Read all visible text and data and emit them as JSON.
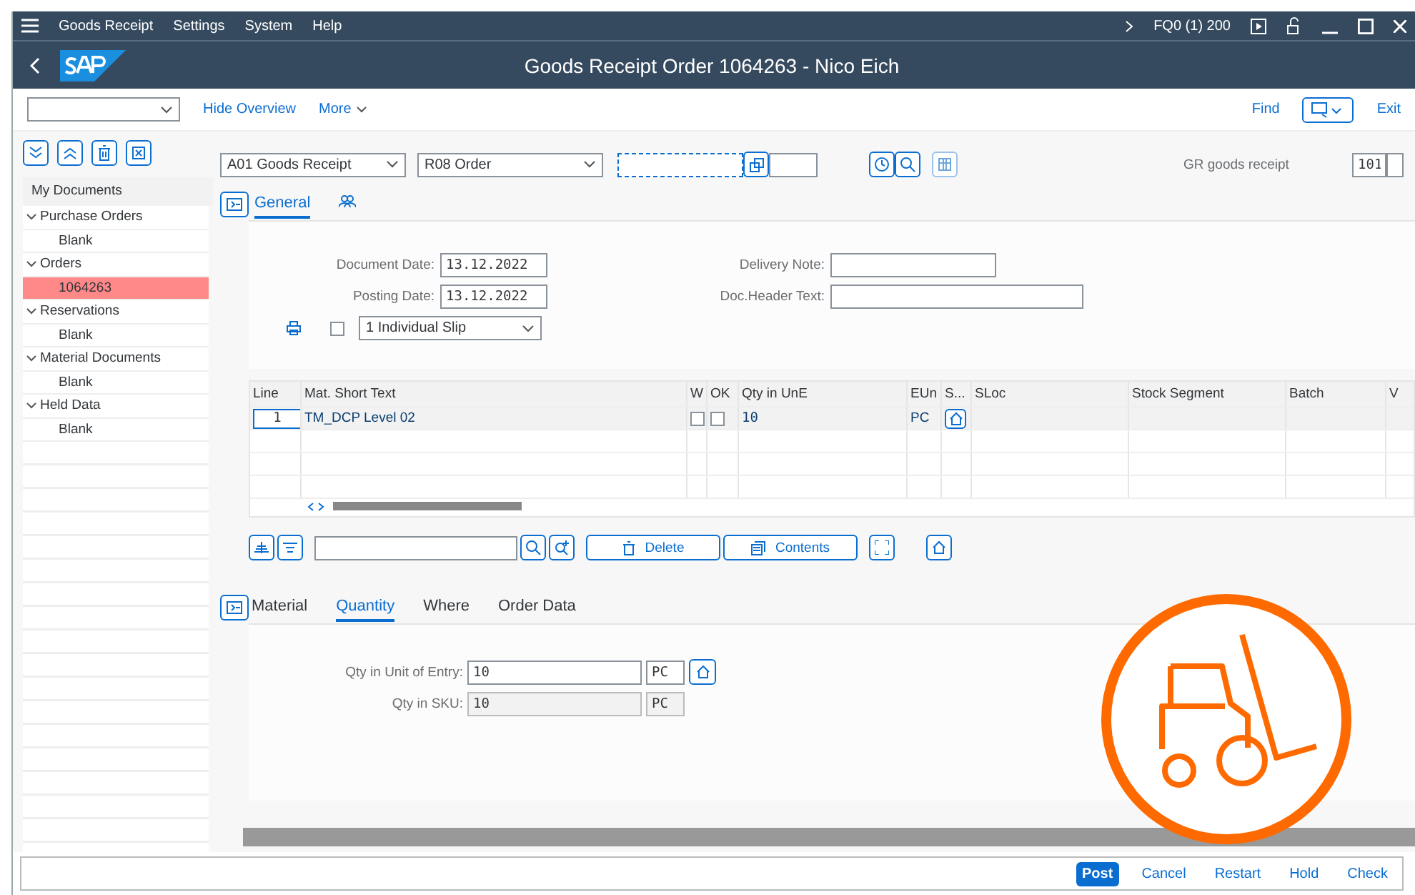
{
  "menu_bar": {
    "items": [
      "Goods Receipt",
      "Settings",
      "System",
      "Help"
    ],
    "system": "FQ0 (1) 200"
  },
  "title": "Goods Receipt Order 1064263 - Nico Eich",
  "toolbar": {
    "links": [
      "Hide Overview",
      "More"
    ],
    "right": [
      "Find",
      "Exit"
    ]
  },
  "tree": {
    "header": "My Documents",
    "items": [
      {
        "label": "Purchase Orders",
        "expanded": true,
        "selected": false,
        "children": [
          {
            "label": "Blank",
            "selected": false
          }
        ]
      },
      {
        "label": "Orders",
        "expanded": true,
        "selected": false,
        "children": [
          {
            "label": "1064263",
            "selected": true
          }
        ]
      },
      {
        "label": "Reservations",
        "expanded": true,
        "selected": false,
        "children": [
          {
            "label": "Blank",
            "selected": false
          }
        ]
      },
      {
        "label": "Material Documents",
        "expanded": true,
        "selected": false,
        "children": [
          {
            "label": "Blank",
            "selected": false
          }
        ]
      },
      {
        "label": "Held Data",
        "expanded": true,
        "selected": false,
        "children": [
          {
            "label": "Blank",
            "selected": false
          }
        ]
      }
    ]
  },
  "header": {
    "transaction": "A01 Goods Receipt",
    "reference": "R08 Order",
    "movement_label": "GR goods receipt",
    "movement_type": "101"
  },
  "header_tabs": [
    {
      "kind": "text",
      "label": "General",
      "selected": true
    },
    {
      "kind": "icon",
      "selected": false
    }
  ],
  "general": {
    "dates": [
      {
        "label": "Document Date:",
        "value": "13.12.2022"
      },
      {
        "label": "Posting Date:",
        "value": "13.12.2022"
      }
    ],
    "texts": [
      {
        "label": "Delivery Note:"
      },
      {
        "label": "Doc.Header Text:"
      }
    ],
    "print_checked": false,
    "slip": "1 Individual Slip"
  },
  "items_table": {
    "columns": [
      "Line",
      "Mat. Short Text",
      "W",
      "OK",
      "Qty in UnE",
      "EUn",
      "S...",
      "SLoc",
      "Stock Segment",
      "Batch",
      "V"
    ],
    "rows": [
      {
        "line": "1",
        "text": "TM_DCP Level 02",
        "w": false,
        "ok": false,
        "qty": "10",
        "unit": "PC"
      }
    ]
  },
  "table_toolbar": {
    "buttons": [
      "Delete",
      "Contents"
    ]
  },
  "detail_tabs": [
    {
      "label": "Material",
      "selected": false
    },
    {
      "label": "Quantity",
      "selected": true
    },
    {
      "label": "Where",
      "selected": false
    },
    {
      "label": "Order Data",
      "selected": false
    }
  ],
  "quantity": {
    "fields": [
      {
        "label": "Qty in Unit of Entry:",
        "value": "10",
        "unit": "PC",
        "editable": true
      },
      {
        "label": "Qty in SKU:",
        "value": "10",
        "unit": "PC",
        "editable": false
      }
    ]
  },
  "footer": {
    "buttons": [
      {
        "label": "Post",
        "kind": "primary"
      },
      {
        "label": "Cancel",
        "kind": "link"
      },
      {
        "label": "Restart",
        "kind": "link"
      },
      {
        "label": "Hold",
        "kind": "link"
      },
      {
        "label": "Check",
        "kind": "link"
      }
    ]
  }
}
